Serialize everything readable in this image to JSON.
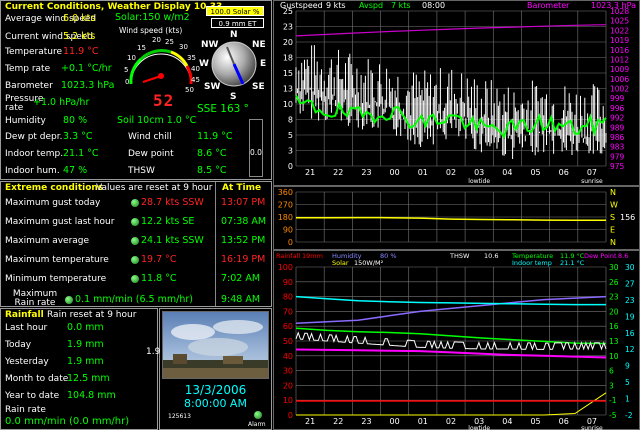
{
  "current": {
    "title": "Current Conditions, Weather Display 10.33",
    "solar_btn": "100.0 Solar %",
    "et_btn": "0.9 mm ET",
    "solar_text": "Solar:150 w/m2",
    "wind_speed_caption": "Wind speed (kts)",
    "avg_wind_label": "Average wind speed",
    "avg_wind_value": "6.0 kts",
    "cur_wind_label": "Current wind speed",
    "cur_wind_value": "5.2 kts",
    "temp_label": "Temperature",
    "temp_value": "11.9 °C",
    "temprate_label": "Temp rate",
    "temprate_value": "+0.1 °C/hr",
    "baro_label": "Barometer",
    "baro_value": "1023.3 hPa",
    "press_label": "Pressure rate",
    "press_value": "+1.0 hPa/hr",
    "humid_label": "Humidity",
    "humid_value": "80 %",
    "soil_value": "Soil 10cm 1.0 °C",
    "dew_label": "Dew pt depr.",
    "dew_value": "3.3 °C",
    "windchill_label": "Wind chill",
    "windchill_value": "11.9 °C",
    "indoor_label": "Indoor temp.",
    "indoor_value": "21.1 °C",
    "dewpoint_label": "Dew point",
    "dewpoint_value": "8.6 °C",
    "indoorhum_label": "Indoor hum.",
    "indoorhum_value": "47 %",
    "thsw_label": "THSW",
    "thsw_value": "8.5 °C",
    "direction_value": "SSE 163 °",
    "gauge_big_value": "52",
    "side_value": "0.0",
    "dial_ticks": [
      "20",
      "25",
      "30",
      "15",
      "35",
      "10",
      "40",
      "5",
      "45",
      "0",
      "50"
    ],
    "compass": [
      "N",
      "NE",
      "E",
      "SE",
      "S",
      "SW",
      "W",
      "NW"
    ]
  },
  "extreme": {
    "title": "Extreme conditions",
    "note": "Values are reset at 9 hour",
    "at_time": "At Time",
    "rows": [
      {
        "label": "Maximum gust today",
        "value": "28.7 kts SSW",
        "time": "13:07 PM",
        "vcolor": "#ff2222",
        "tcolor": "#ff2222"
      },
      {
        "label": "Maximum gust last hour",
        "value": "12.2 kts  SE",
        "time": "07:38 AM",
        "vcolor": "#00ff00",
        "tcolor": "#00ff00"
      },
      {
        "label": "Maximum average",
        "value": "24.1 kts SSW",
        "time": "13:52 PM",
        "vcolor": "#00ff00",
        "tcolor": "#00ff00"
      },
      {
        "label": "Maximum temperature",
        "value": "19.7 °C",
        "time": "16:19 PM",
        "vcolor": "#ff2222",
        "tcolor": "#ff2222"
      },
      {
        "label": "Minimum temperature",
        "value": "11.8 °C",
        "time": "7:02 AM",
        "vcolor": "#00ff00",
        "tcolor": "#00ff00"
      },
      {
        "label": "Maximum Rain rate",
        "value": "0.1 mm/min (6.5 mm/hr)",
        "time": "9:48 AM",
        "vcolor": "#00ff00",
        "tcolor": "#00ff00"
      }
    ]
  },
  "rainfall": {
    "title": "Rainfall",
    "note": "Rain reset at 9 hour",
    "rows": [
      {
        "label": "Last hour",
        "value": "0.0 mm"
      },
      {
        "label": "Today",
        "value": "1.9 mm"
      },
      {
        "label": "Yesterday",
        "value": "1.9 mm"
      },
      {
        "label": "Month to date",
        "value": "12.5 mm"
      },
      {
        "label": "Year to date",
        "value": "104.8 mm"
      }
    ],
    "rate_label": "Rain rate",
    "rate_value": "0.0 mm/min (0.0 mm/hr)"
  },
  "cam": {
    "side_value": "1.9",
    "date": "13/3/2006",
    "time": "8:00:00 AM",
    "counter": "125613",
    "alarm": "Alarm"
  },
  "charts": {
    "top": {
      "legend_gust": "Gustspeed",
      "legend_gust_val": "9 kts",
      "legend_avg": "Avspd",
      "legend_avg_val": "7 kts",
      "legend_time": "08:00",
      "legend_baro": "Barometer",
      "legend_baro_val": "1023.3 hPa",
      "left_ticks": [
        "25",
        "23",
        "20",
        "18",
        "15",
        "13",
        "10",
        "8",
        "5",
        "3",
        "0"
      ],
      "right_ticks": [
        "1028",
        "1025",
        "1022",
        "1019",
        "1016",
        "1012",
        "1009",
        "1006",
        "1002",
        "999",
        "996",
        "992",
        "989",
        "986",
        "983",
        "979",
        "975"
      ],
      "x_ticks": [
        "21",
        "22",
        "23",
        "00",
        "01",
        "02",
        "03",
        "04",
        "05",
        "06",
        "07"
      ],
      "x_sub": [
        "lowtide",
        "sunrise"
      ]
    },
    "dir": {
      "left_ticks": [
        "360",
        "270",
        "180",
        "90",
        "0"
      ],
      "right_labels": [
        "N",
        "W",
        "S",
        "E",
        "N"
      ],
      "value": "156"
    },
    "bottom": {
      "legend1": [
        "Rainfall",
        "19mm",
        "Humidity",
        "80 %",
        "THSW",
        "10.6",
        "Temperature",
        "11.9 °C",
        "Dew Point",
        "8.6"
      ],
      "legend2": [
        "Solar",
        "150W/M²",
        "Indoor temp",
        "21.1 °C"
      ],
      "left_ticks": [
        "100",
        "90",
        "80",
        "70",
        "60",
        "50",
        "40",
        "30",
        "20",
        "10",
        "0"
      ],
      "right_ticks": [
        "30",
        "26",
        "23",
        "20",
        "16",
        "13",
        "10",
        "6",
        "3",
        "-1",
        "-5"
      ],
      "right_ticks2": [
        "30",
        "27",
        "23",
        "19",
        "16",
        "12",
        "9",
        "5",
        "1",
        "-2"
      ],
      "x_ticks": [
        "21",
        "22",
        "23",
        "00",
        "01",
        "02",
        "03",
        "04",
        "05",
        "06",
        "07"
      ],
      "x_sub": [
        "lowtide",
        "sunrise"
      ]
    }
  },
  "chart_data": [
    {
      "type": "line",
      "title": "",
      "x": [
        "21",
        "22",
        "23",
        "00",
        "01",
        "02",
        "03",
        "04",
        "05",
        "06",
        "07"
      ],
      "series": [
        {
          "name": "Gustspeed",
          "values": [
            16,
            15,
            14,
            13,
            11,
            12,
            10,
            9,
            10,
            9,
            9
          ]
        },
        {
          "name": "Avspd",
          "values": [
            10,
            9,
            8,
            9,
            7,
            8,
            6,
            6,
            7,
            6,
            7
          ]
        },
        {
          "name": "Barometer",
          "values": [
            1019.5,
            1020,
            1020.5,
            1021,
            1021.4,
            1021.8,
            1022.2,
            1022.5,
            1022.8,
            1023.1,
            1023.3
          ]
        }
      ],
      "ylim": [
        0,
        25
      ],
      "y2lim": [
        975,
        1028
      ],
      "colors": {
        "gust": "#ffffff",
        "avg": "#00ff00",
        "baro": "#cc00cc"
      }
    },
    {
      "type": "line",
      "x": [
        "21",
        "22",
        "23",
        "00",
        "01",
        "02",
        "03",
        "04",
        "05",
        "06",
        "07"
      ],
      "series": [
        {
          "name": "",
          "values": [
            175,
            175,
            176,
            175,
            172,
            165,
            162,
            160,
            158,
            157,
            156
          ]
        }
      ],
      "ylim": [
        0,
        360
      ]
    },
    {
      "type": "line",
      "x": [
        "21",
        "22",
        "23",
        "00",
        "01",
        "02",
        "03",
        "04",
        "05",
        "06",
        "07"
      ],
      "series": [
        {
          "name": "Humidity",
          "values": [
            62,
            63,
            64,
            67,
            70,
            72,
            74,
            76,
            78,
            79,
            80
          ]
        },
        {
          "name": "Indoor temp",
          "values": [
            23,
            22.5,
            22,
            21.8,
            21.6,
            21.5,
            21.4,
            21.3,
            21.2,
            21.1,
            21.1
          ]
        },
        {
          "name": "Temperature",
          "values": [
            15.5,
            15,
            14.7,
            14.5,
            14.2,
            13.7,
            13.2,
            12.8,
            12.4,
            12,
            11.9
          ]
        },
        {
          "name": "Dew Point",
          "values": [
            10.5,
            10.4,
            10.3,
            10.2,
            10.1,
            9.8,
            9.5,
            9.2,
            9,
            8.8,
            8.6
          ]
        },
        {
          "name": "THSW",
          "values": [
            13,
            12.5,
            12,
            11.5,
            11,
            10.8,
            10.6,
            10.6,
            10.5,
            10.6,
            10.6
          ]
        },
        {
          "name": "Solar",
          "values": [
            0,
            0,
            0,
            0,
            0,
            0,
            0,
            0,
            0,
            10,
            150
          ]
        },
        {
          "name": "Rainfall",
          "values": [
            0,
            0,
            0,
            0,
            0,
            0,
            0,
            0,
            0,
            0,
            0
          ]
        }
      ],
      "ylim": [
        0,
        100
      ],
      "y2lim": [
        -5,
        30
      ]
    }
  ]
}
